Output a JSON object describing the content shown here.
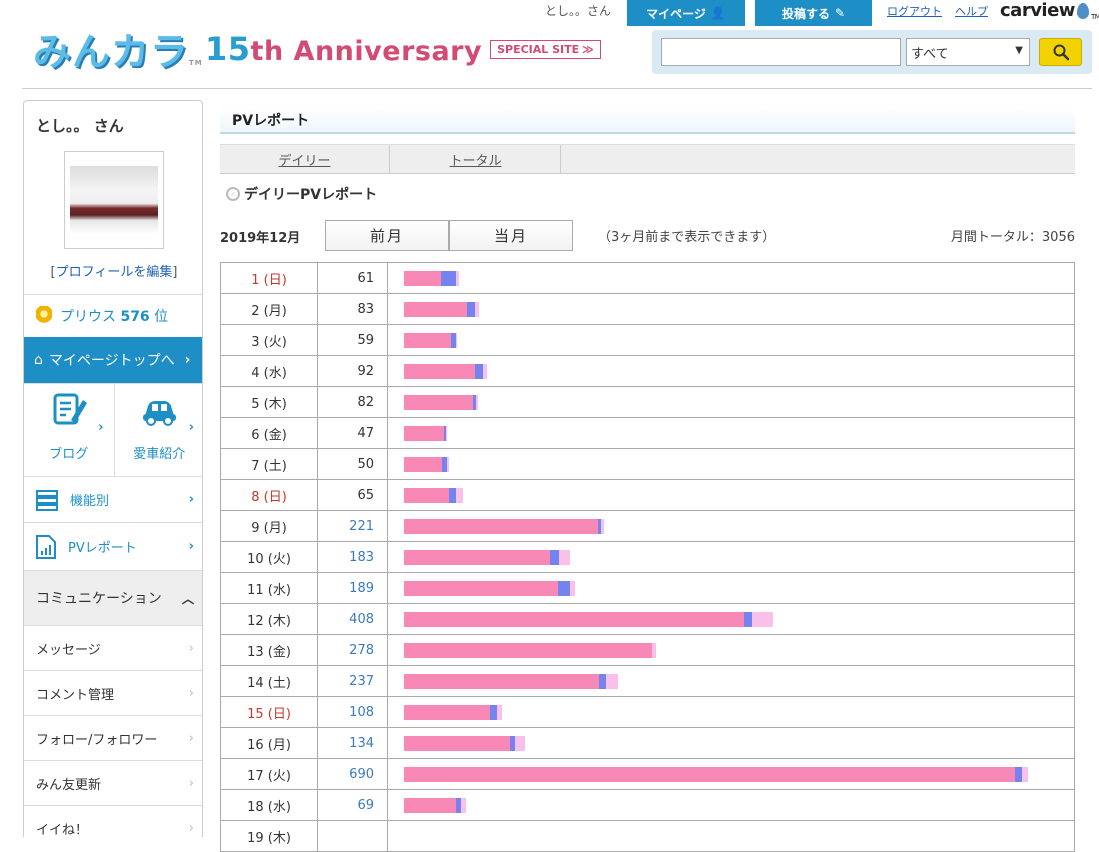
{
  "header": {
    "greeting": "とし。。さん",
    "mypage_label": "マイページ",
    "post_label": "投稿する",
    "logout_label": "ログアウト",
    "help_label": "ヘルプ",
    "carview_logo": "carview",
    "site_logo": "みんカラ",
    "anniv_num": "15",
    "anniv_text": "th Anniversary",
    "special_site": "SPECIAL SITE",
    "search_placeholder": "",
    "search_scope": "すべて"
  },
  "sidebar": {
    "user_name": "とし。。 さん",
    "edit_profile": "プロフィールを編集",
    "rank_text": "プリウス",
    "rank_num": "576",
    "rank_unit": "位",
    "mypage_top": "マイページトップへ",
    "blog": "ブログ",
    "car_intro": "愛車紹介",
    "functions": "機能別",
    "pv_report": "PVレポート",
    "communication": "コミュニケーション",
    "sub_items": [
      "メッセージ",
      "コメント管理",
      "フォロー/フォロワー",
      "みん友更新",
      "イイね！"
    ]
  },
  "main": {
    "title": "PVレポート",
    "tab_daily": "デイリー",
    "tab_total": "トータル",
    "section_title": "デイリーPVレポート",
    "month": "2019年12月",
    "prev_month": "前月",
    "curr_month": "当月",
    "note": "（3ヶ月前まで表示できます）",
    "monthly_total": "月間トータル：3056"
  },
  "colors": {
    "accent": "#1e8fc6",
    "bar_pink": "#f889b6",
    "bar_blue": "#7583ef",
    "bar_lavender": "#f9c1ea"
  },
  "chart_data": {
    "type": "bar",
    "categories": [
      "1 (日)",
      "2 (月)",
      "3 (火)",
      "4 (水)",
      "5 (木)",
      "6 (金)",
      "7 (土)",
      "8 (日)",
      "9 (月)",
      "10 (火)",
      "11 (水)",
      "12 (木)",
      "13 (金)",
      "14 (土)",
      "15 (日)",
      "16 (月)",
      "17 (火)",
      "18 (水)",
      "19 (木)"
    ],
    "sunday": [
      true,
      false,
      false,
      false,
      false,
      false,
      false,
      true,
      false,
      false,
      false,
      false,
      false,
      false,
      true,
      false,
      false,
      false,
      false
    ],
    "linked": [
      false,
      false,
      false,
      false,
      false,
      false,
      false,
      false,
      true,
      true,
      true,
      true,
      true,
      true,
      true,
      true,
      true,
      true,
      false
    ],
    "values": [
      61,
      83,
      59,
      92,
      82,
      47,
      50,
      65,
      221,
      183,
      189,
      408,
      278,
      237,
      108,
      134,
      690,
      69,
      null
    ],
    "series": [
      {
        "values": [
          41,
          70,
          52,
          78,
          76,
          44,
          42,
          50,
          214,
          161,
          170,
          376,
          274,
          216,
          95,
          117,
          675,
          57,
          null
        ]
      },
      {
        "values": [
          16,
          9,
          6,
          9,
          4,
          2,
          5,
          7,
          4,
          10,
          13,
          9,
          0,
          7,
          8,
          6,
          8,
          6,
          null
        ]
      },
      {
        "values": [
          4,
          4,
          1,
          5,
          2,
          1,
          3,
          8,
          3,
          12,
          6,
          23,
          4,
          14,
          5,
          11,
          7,
          6,
          null
        ]
      }
    ]
  }
}
